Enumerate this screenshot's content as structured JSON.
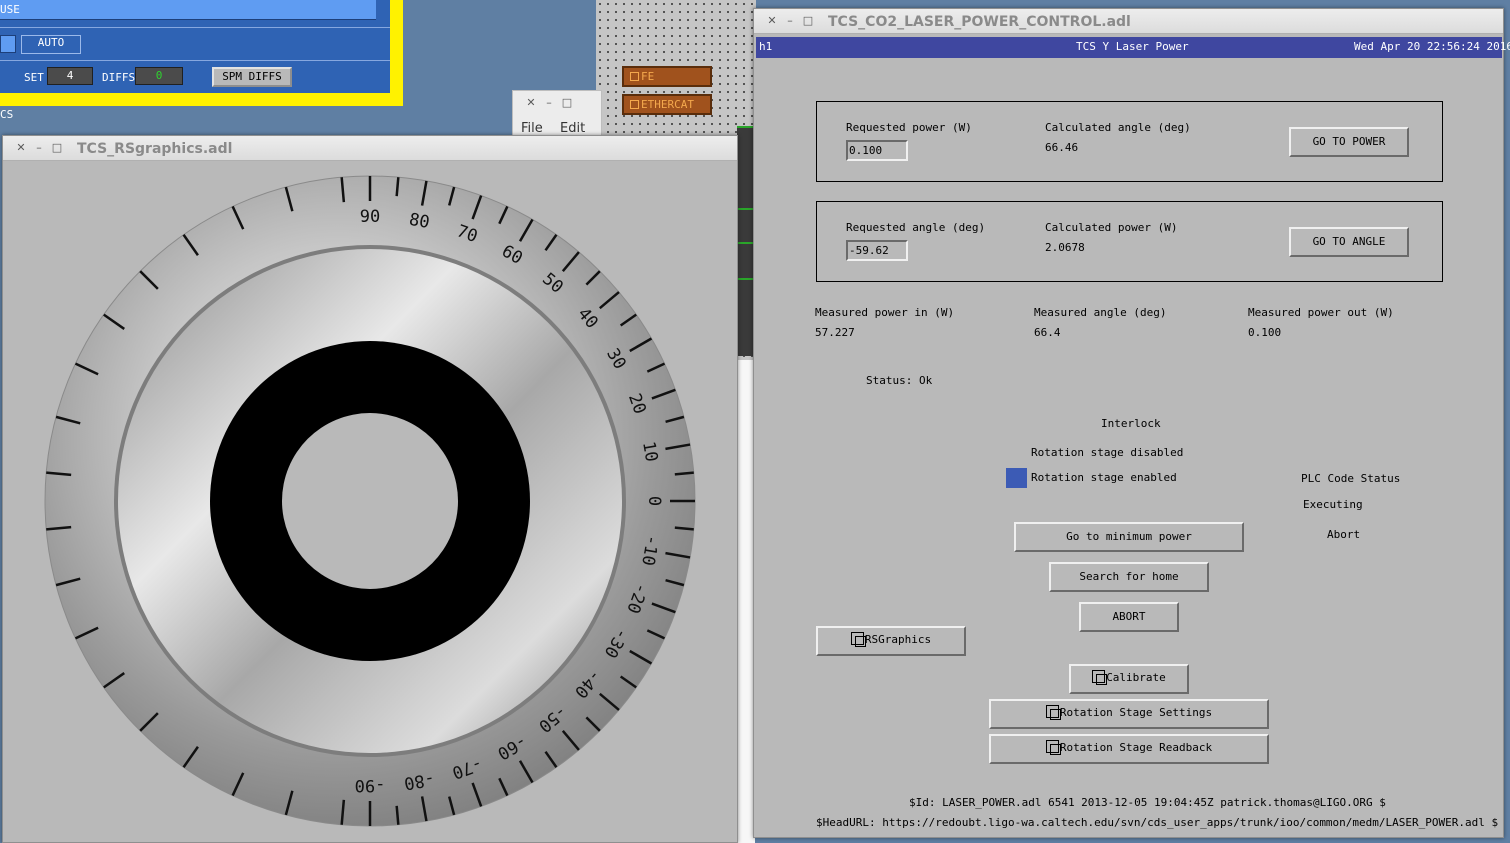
{
  "background": {
    "top_left_label": "USE",
    "auto_button": "AUTO",
    "set_label": "SET",
    "set_value": "4",
    "diffs_label": "DIFFS",
    "diffs_value": "0",
    "spm_diffs_button": "SPM DIFFS",
    "cs_label": "CS",
    "fe_button": "FE",
    "ethercat_button": "ETHERCAT",
    "small_window_menu": [
      "File",
      "Edit"
    ]
  },
  "rsgraphics_window": {
    "title": "TCS_RSgraphics.adl",
    "dial": {
      "outer_labels": [
        "90",
        "80",
        "70",
        "60",
        "50",
        "40",
        "30",
        "20",
        "10",
        "0",
        "-10",
        "-20",
        "-30",
        "-40",
        "-50",
        "-60",
        "-70",
        "-80",
        "-90"
      ]
    }
  },
  "laser_window": {
    "title": "TCS_CO2_LASER_POWER_CONTROL.adl",
    "header": {
      "left": "h1",
      "center": "TCS Y Laser Power",
      "right": "Wed Apr 20 22:56:24 2016"
    },
    "power_box": {
      "requested_label": "Requested power (W)",
      "requested_value": "0.100",
      "calculated_label": "Calculated angle (deg)",
      "calculated_value": "66.46",
      "button": "GO TO POWER"
    },
    "angle_box": {
      "requested_label": "Requested angle (deg)",
      "requested_value": "-59.62",
      "calculated_label": "Calculated power (W)",
      "calculated_value": "2.0678",
      "button": "GO TO ANGLE"
    },
    "measured": {
      "power_in_label": "Measured power in (W)",
      "power_in_value": "57.227",
      "angle_label": "Measured angle (deg)",
      "angle_value": "66.4",
      "power_out_label": "Measured power out (W)",
      "power_out_value": "0.100"
    },
    "status": "Status: Ok",
    "interlock": {
      "title": "Interlock",
      "disabled": "Rotation stage disabled",
      "enabled": "Rotation stage enabled",
      "enabled_color": "#3c5bb5"
    },
    "plc": {
      "title": "PLC Code Status",
      "executing": "Executing",
      "abort": "Abort"
    },
    "buttons": {
      "min_power": "Go to minimum power",
      "search_home": "Search for home",
      "abort": "ABORT",
      "rsgraphics": "RSGraphics",
      "calibrate": "Calibrate",
      "rs_settings": "Rotation Stage Settings",
      "rs_readback": "Rotation Stage Readback"
    },
    "footer": {
      "id_line": "$Id: LASER_POWER.adl 6541 2013-12-05 19:04:45Z patrick.thomas@LIGO.ORG $",
      "url_line": "$HeadURL: https://redoubt.ligo-wa.caltech.edu/svn/cds_user_apps/trunk/ioo/common/medm/LASER_POWER.adl $"
    }
  }
}
